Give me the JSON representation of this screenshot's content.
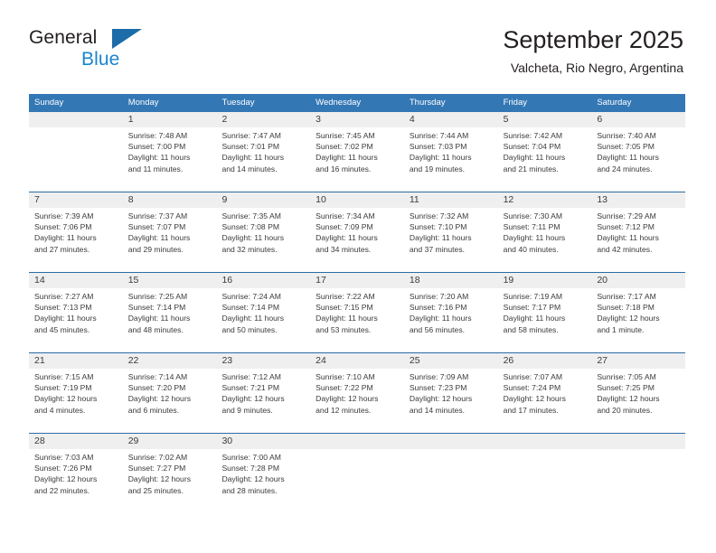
{
  "brand": {
    "word_one": "General",
    "word_two": "Blue",
    "triangle_icon": "blue-triangle-logo"
  },
  "header": {
    "month_title": "September 2025",
    "location": "Valcheta, Rio Negro, Argentina"
  },
  "colors": {
    "header_blue": "#3477b5",
    "row_separator_blue": "#2b6ca6",
    "daynum_band": "#efefef",
    "brand_dark": "#231f20",
    "brand_blue": "#1b84d0",
    "text": "#3a3a3a"
  },
  "weekdays": [
    "Sunday",
    "Monday",
    "Tuesday",
    "Wednesday",
    "Thursday",
    "Friday",
    "Saturday"
  ],
  "weeks": [
    [
      {
        "day": "",
        "sunrise": "",
        "sunset": "",
        "daylight_1": "",
        "daylight_2": ""
      },
      {
        "day": "1",
        "sunrise": "Sunrise: 7:48 AM",
        "sunset": "Sunset: 7:00 PM",
        "daylight_1": "Daylight: 11 hours",
        "daylight_2": "and 11 minutes."
      },
      {
        "day": "2",
        "sunrise": "Sunrise: 7:47 AM",
        "sunset": "Sunset: 7:01 PM",
        "daylight_1": "Daylight: 11 hours",
        "daylight_2": "and 14 minutes."
      },
      {
        "day": "3",
        "sunrise": "Sunrise: 7:45 AM",
        "sunset": "Sunset: 7:02 PM",
        "daylight_1": "Daylight: 11 hours",
        "daylight_2": "and 16 minutes."
      },
      {
        "day": "4",
        "sunrise": "Sunrise: 7:44 AM",
        "sunset": "Sunset: 7:03 PM",
        "daylight_1": "Daylight: 11 hours",
        "daylight_2": "and 19 minutes."
      },
      {
        "day": "5",
        "sunrise": "Sunrise: 7:42 AM",
        "sunset": "Sunset: 7:04 PM",
        "daylight_1": "Daylight: 11 hours",
        "daylight_2": "and 21 minutes."
      },
      {
        "day": "6",
        "sunrise": "Sunrise: 7:40 AM",
        "sunset": "Sunset: 7:05 PM",
        "daylight_1": "Daylight: 11 hours",
        "daylight_2": "and 24 minutes."
      }
    ],
    [
      {
        "day": "7",
        "sunrise": "Sunrise: 7:39 AM",
        "sunset": "Sunset: 7:06 PM",
        "daylight_1": "Daylight: 11 hours",
        "daylight_2": "and 27 minutes."
      },
      {
        "day": "8",
        "sunrise": "Sunrise: 7:37 AM",
        "sunset": "Sunset: 7:07 PM",
        "daylight_1": "Daylight: 11 hours",
        "daylight_2": "and 29 minutes."
      },
      {
        "day": "9",
        "sunrise": "Sunrise: 7:35 AM",
        "sunset": "Sunset: 7:08 PM",
        "daylight_1": "Daylight: 11 hours",
        "daylight_2": "and 32 minutes."
      },
      {
        "day": "10",
        "sunrise": "Sunrise: 7:34 AM",
        "sunset": "Sunset: 7:09 PM",
        "daylight_1": "Daylight: 11 hours",
        "daylight_2": "and 34 minutes."
      },
      {
        "day": "11",
        "sunrise": "Sunrise: 7:32 AM",
        "sunset": "Sunset: 7:10 PM",
        "daylight_1": "Daylight: 11 hours",
        "daylight_2": "and 37 minutes."
      },
      {
        "day": "12",
        "sunrise": "Sunrise: 7:30 AM",
        "sunset": "Sunset: 7:11 PM",
        "daylight_1": "Daylight: 11 hours",
        "daylight_2": "and 40 minutes."
      },
      {
        "day": "13",
        "sunrise": "Sunrise: 7:29 AM",
        "sunset": "Sunset: 7:12 PM",
        "daylight_1": "Daylight: 11 hours",
        "daylight_2": "and 42 minutes."
      }
    ],
    [
      {
        "day": "14",
        "sunrise": "Sunrise: 7:27 AM",
        "sunset": "Sunset: 7:13 PM",
        "daylight_1": "Daylight: 11 hours",
        "daylight_2": "and 45 minutes."
      },
      {
        "day": "15",
        "sunrise": "Sunrise: 7:25 AM",
        "sunset": "Sunset: 7:14 PM",
        "daylight_1": "Daylight: 11 hours",
        "daylight_2": "and 48 minutes."
      },
      {
        "day": "16",
        "sunrise": "Sunrise: 7:24 AM",
        "sunset": "Sunset: 7:14 PM",
        "daylight_1": "Daylight: 11 hours",
        "daylight_2": "and 50 minutes."
      },
      {
        "day": "17",
        "sunrise": "Sunrise: 7:22 AM",
        "sunset": "Sunset: 7:15 PM",
        "daylight_1": "Daylight: 11 hours",
        "daylight_2": "and 53 minutes."
      },
      {
        "day": "18",
        "sunrise": "Sunrise: 7:20 AM",
        "sunset": "Sunset: 7:16 PM",
        "daylight_1": "Daylight: 11 hours",
        "daylight_2": "and 56 minutes."
      },
      {
        "day": "19",
        "sunrise": "Sunrise: 7:19 AM",
        "sunset": "Sunset: 7:17 PM",
        "daylight_1": "Daylight: 11 hours",
        "daylight_2": "and 58 minutes."
      },
      {
        "day": "20",
        "sunrise": "Sunrise: 7:17 AM",
        "sunset": "Sunset: 7:18 PM",
        "daylight_1": "Daylight: 12 hours",
        "daylight_2": "and 1 minute."
      }
    ],
    [
      {
        "day": "21",
        "sunrise": "Sunrise: 7:15 AM",
        "sunset": "Sunset: 7:19 PM",
        "daylight_1": "Daylight: 12 hours",
        "daylight_2": "and 4 minutes."
      },
      {
        "day": "22",
        "sunrise": "Sunrise: 7:14 AM",
        "sunset": "Sunset: 7:20 PM",
        "daylight_1": "Daylight: 12 hours",
        "daylight_2": "and 6 minutes."
      },
      {
        "day": "23",
        "sunrise": "Sunrise: 7:12 AM",
        "sunset": "Sunset: 7:21 PM",
        "daylight_1": "Daylight: 12 hours",
        "daylight_2": "and 9 minutes."
      },
      {
        "day": "24",
        "sunrise": "Sunrise: 7:10 AM",
        "sunset": "Sunset: 7:22 PM",
        "daylight_1": "Daylight: 12 hours",
        "daylight_2": "and 12 minutes."
      },
      {
        "day": "25",
        "sunrise": "Sunrise: 7:09 AM",
        "sunset": "Sunset: 7:23 PM",
        "daylight_1": "Daylight: 12 hours",
        "daylight_2": "and 14 minutes."
      },
      {
        "day": "26",
        "sunrise": "Sunrise: 7:07 AM",
        "sunset": "Sunset: 7:24 PM",
        "daylight_1": "Daylight: 12 hours",
        "daylight_2": "and 17 minutes."
      },
      {
        "day": "27",
        "sunrise": "Sunrise: 7:05 AM",
        "sunset": "Sunset: 7:25 PM",
        "daylight_1": "Daylight: 12 hours",
        "daylight_2": "and 20 minutes."
      }
    ],
    [
      {
        "day": "28",
        "sunrise": "Sunrise: 7:03 AM",
        "sunset": "Sunset: 7:26 PM",
        "daylight_1": "Daylight: 12 hours",
        "daylight_2": "and 22 minutes."
      },
      {
        "day": "29",
        "sunrise": "Sunrise: 7:02 AM",
        "sunset": "Sunset: 7:27 PM",
        "daylight_1": "Daylight: 12 hours",
        "daylight_2": "and 25 minutes."
      },
      {
        "day": "30",
        "sunrise": "Sunrise: 7:00 AM",
        "sunset": "Sunset: 7:28 PM",
        "daylight_1": "Daylight: 12 hours",
        "daylight_2": "and 28 minutes."
      },
      {
        "day": "",
        "sunrise": "",
        "sunset": "",
        "daylight_1": "",
        "daylight_2": ""
      },
      {
        "day": "",
        "sunrise": "",
        "sunset": "",
        "daylight_1": "",
        "daylight_2": ""
      },
      {
        "day": "",
        "sunrise": "",
        "sunset": "",
        "daylight_1": "",
        "daylight_2": ""
      },
      {
        "day": "",
        "sunrise": "",
        "sunset": "",
        "daylight_1": "",
        "daylight_2": ""
      }
    ]
  ]
}
